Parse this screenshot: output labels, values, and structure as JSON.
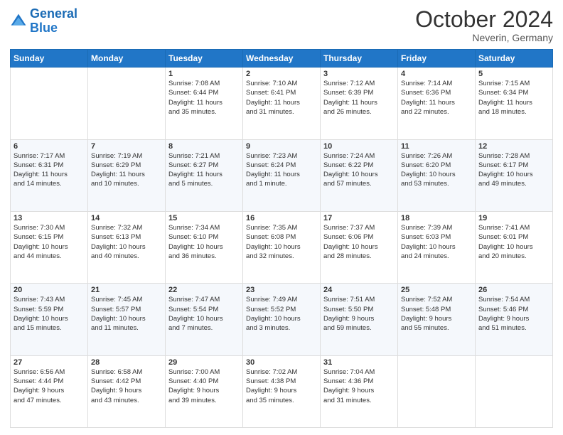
{
  "header": {
    "logo_line1": "General",
    "logo_line2": "Blue",
    "month": "October 2024",
    "location": "Neverin, Germany"
  },
  "days_of_week": [
    "Sunday",
    "Monday",
    "Tuesday",
    "Wednesday",
    "Thursday",
    "Friday",
    "Saturday"
  ],
  "weeks": [
    [
      {
        "day": "",
        "info": ""
      },
      {
        "day": "",
        "info": ""
      },
      {
        "day": "1",
        "info": "Sunrise: 7:08 AM\nSunset: 6:44 PM\nDaylight: 11 hours\nand 35 minutes."
      },
      {
        "day": "2",
        "info": "Sunrise: 7:10 AM\nSunset: 6:41 PM\nDaylight: 11 hours\nand 31 minutes."
      },
      {
        "day": "3",
        "info": "Sunrise: 7:12 AM\nSunset: 6:39 PM\nDaylight: 11 hours\nand 26 minutes."
      },
      {
        "day": "4",
        "info": "Sunrise: 7:14 AM\nSunset: 6:36 PM\nDaylight: 11 hours\nand 22 minutes."
      },
      {
        "day": "5",
        "info": "Sunrise: 7:15 AM\nSunset: 6:34 PM\nDaylight: 11 hours\nand 18 minutes."
      }
    ],
    [
      {
        "day": "6",
        "info": "Sunrise: 7:17 AM\nSunset: 6:31 PM\nDaylight: 11 hours\nand 14 minutes."
      },
      {
        "day": "7",
        "info": "Sunrise: 7:19 AM\nSunset: 6:29 PM\nDaylight: 11 hours\nand 10 minutes."
      },
      {
        "day": "8",
        "info": "Sunrise: 7:21 AM\nSunset: 6:27 PM\nDaylight: 11 hours\nand 5 minutes."
      },
      {
        "day": "9",
        "info": "Sunrise: 7:23 AM\nSunset: 6:24 PM\nDaylight: 11 hours\nand 1 minute."
      },
      {
        "day": "10",
        "info": "Sunrise: 7:24 AM\nSunset: 6:22 PM\nDaylight: 10 hours\nand 57 minutes."
      },
      {
        "day": "11",
        "info": "Sunrise: 7:26 AM\nSunset: 6:20 PM\nDaylight: 10 hours\nand 53 minutes."
      },
      {
        "day": "12",
        "info": "Sunrise: 7:28 AM\nSunset: 6:17 PM\nDaylight: 10 hours\nand 49 minutes."
      }
    ],
    [
      {
        "day": "13",
        "info": "Sunrise: 7:30 AM\nSunset: 6:15 PM\nDaylight: 10 hours\nand 44 minutes."
      },
      {
        "day": "14",
        "info": "Sunrise: 7:32 AM\nSunset: 6:13 PM\nDaylight: 10 hours\nand 40 minutes."
      },
      {
        "day": "15",
        "info": "Sunrise: 7:34 AM\nSunset: 6:10 PM\nDaylight: 10 hours\nand 36 minutes."
      },
      {
        "day": "16",
        "info": "Sunrise: 7:35 AM\nSunset: 6:08 PM\nDaylight: 10 hours\nand 32 minutes."
      },
      {
        "day": "17",
        "info": "Sunrise: 7:37 AM\nSunset: 6:06 PM\nDaylight: 10 hours\nand 28 minutes."
      },
      {
        "day": "18",
        "info": "Sunrise: 7:39 AM\nSunset: 6:03 PM\nDaylight: 10 hours\nand 24 minutes."
      },
      {
        "day": "19",
        "info": "Sunrise: 7:41 AM\nSunset: 6:01 PM\nDaylight: 10 hours\nand 20 minutes."
      }
    ],
    [
      {
        "day": "20",
        "info": "Sunrise: 7:43 AM\nSunset: 5:59 PM\nDaylight: 10 hours\nand 15 minutes."
      },
      {
        "day": "21",
        "info": "Sunrise: 7:45 AM\nSunset: 5:57 PM\nDaylight: 10 hours\nand 11 minutes."
      },
      {
        "day": "22",
        "info": "Sunrise: 7:47 AM\nSunset: 5:54 PM\nDaylight: 10 hours\nand 7 minutes."
      },
      {
        "day": "23",
        "info": "Sunrise: 7:49 AM\nSunset: 5:52 PM\nDaylight: 10 hours\nand 3 minutes."
      },
      {
        "day": "24",
        "info": "Sunrise: 7:51 AM\nSunset: 5:50 PM\nDaylight: 9 hours\nand 59 minutes."
      },
      {
        "day": "25",
        "info": "Sunrise: 7:52 AM\nSunset: 5:48 PM\nDaylight: 9 hours\nand 55 minutes."
      },
      {
        "day": "26",
        "info": "Sunrise: 7:54 AM\nSunset: 5:46 PM\nDaylight: 9 hours\nand 51 minutes."
      }
    ],
    [
      {
        "day": "27",
        "info": "Sunrise: 6:56 AM\nSunset: 4:44 PM\nDaylight: 9 hours\nand 47 minutes."
      },
      {
        "day": "28",
        "info": "Sunrise: 6:58 AM\nSunset: 4:42 PM\nDaylight: 9 hours\nand 43 minutes."
      },
      {
        "day": "29",
        "info": "Sunrise: 7:00 AM\nSunset: 4:40 PM\nDaylight: 9 hours\nand 39 minutes."
      },
      {
        "day": "30",
        "info": "Sunrise: 7:02 AM\nSunset: 4:38 PM\nDaylight: 9 hours\nand 35 minutes."
      },
      {
        "day": "31",
        "info": "Sunrise: 7:04 AM\nSunset: 4:36 PM\nDaylight: 9 hours\nand 31 minutes."
      },
      {
        "day": "",
        "info": ""
      },
      {
        "day": "",
        "info": ""
      }
    ]
  ]
}
